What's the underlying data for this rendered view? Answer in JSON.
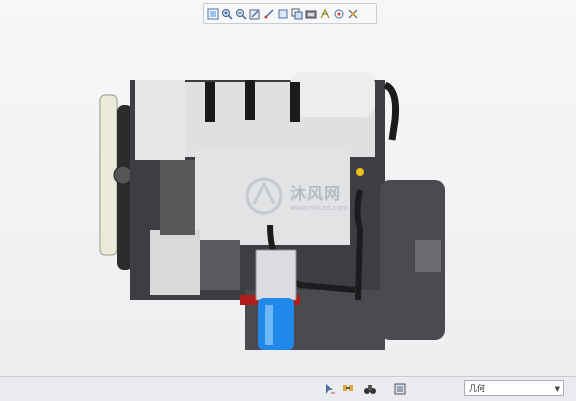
{
  "toolbar": {
    "buttons": [
      {
        "icon": "zoom-fit-icon"
      },
      {
        "icon": "zoom-in-icon"
      },
      {
        "icon": "zoom-out-icon"
      },
      {
        "icon": "repaint-icon"
      },
      {
        "icon": "saved-orientation-icon"
      },
      {
        "icon": "display-style-icon"
      },
      {
        "icon": "view-manager-icon"
      },
      {
        "icon": "perspective-icon"
      },
      {
        "icon": "datum-display-icon"
      },
      {
        "icon": "spin-center-icon"
      },
      {
        "icon": "annotation-display-icon"
      }
    ]
  },
  "watermark": {
    "text": "沐风网",
    "url": "www.mfcad.com"
  },
  "statusbar": {
    "filter_value": "几何",
    "icons": [
      "selection-arrow-icon",
      "find-icon",
      "model-icon"
    ]
  }
}
